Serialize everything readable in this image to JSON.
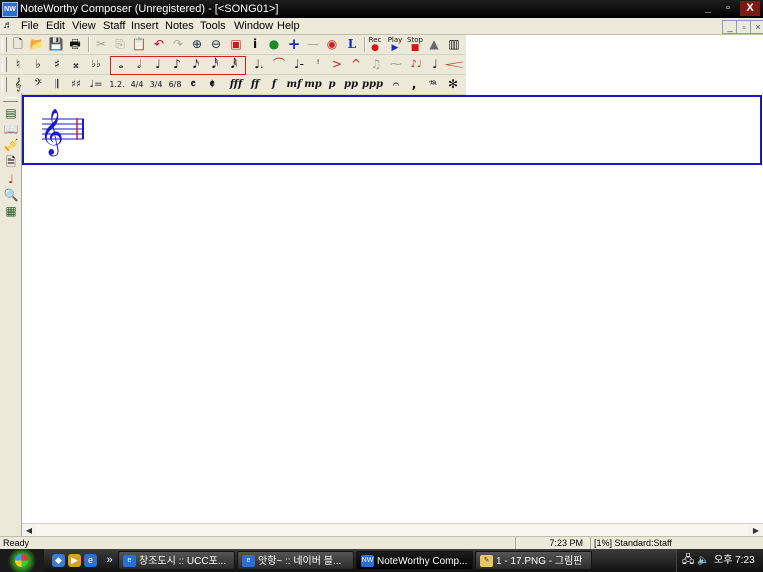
{
  "window": {
    "title": "NoteWorthy Composer (Unregistered) - [<SONG01>]",
    "app_icon_text": "NW",
    "minimize_glyph": "_",
    "restore_glyph": "▫",
    "close_glyph": "X",
    "mdi_minimize_glyph": "_",
    "mdi_restore_glyph": "▫",
    "mdi_close_glyph": "×"
  },
  "menubar": {
    "doc_icon_glyph": "♬",
    "items": [
      "File",
      "Edit",
      "View",
      "Staff",
      "Insert",
      "Notes",
      "Tools",
      "Window",
      "Help"
    ]
  },
  "toolbar_standard": {
    "buttons": [
      {
        "icon": "new-document-icon",
        "glyph": "🗋"
      },
      {
        "icon": "open-folder-icon",
        "glyph": "📂"
      },
      {
        "icon": "save-icon",
        "glyph": "💾"
      },
      {
        "icon": "print-icon",
        "glyph": "🖶"
      },
      {
        "icon": "cut-icon",
        "glyph": "✂"
      },
      {
        "icon": "copy-icon",
        "glyph": "⎘"
      },
      {
        "icon": "paste-icon",
        "glyph": "📋"
      },
      {
        "icon": "undo-icon",
        "glyph": "↶"
      },
      {
        "icon": "redo-icon",
        "glyph": "↷"
      },
      {
        "icon": "zoom-in-icon",
        "glyph": "⊕"
      },
      {
        "icon": "zoom-out-icon",
        "glyph": "⊖"
      },
      {
        "icon": "staff-properties-icon",
        "glyph": "▣"
      },
      {
        "icon": "info-icon",
        "glyph": "i"
      },
      {
        "icon": "globe-icon",
        "glyph": "●"
      },
      {
        "icon": "add-staff-icon",
        "glyph": "+"
      },
      {
        "icon": "delete-staff-icon",
        "glyph": "—"
      },
      {
        "icon": "mute-icon",
        "glyph": "◉"
      },
      {
        "icon": "lyrics-icon",
        "glyph": "L"
      }
    ],
    "rec_label": "Rec",
    "play_label": "Play",
    "stop_label": "Stop",
    "extra_icons": [
      {
        "icon": "metronome-icon",
        "glyph": "▲"
      },
      {
        "icon": "keyboard-icon",
        "glyph": "▥"
      }
    ]
  },
  "toolbar_notes": {
    "accidentals": [
      {
        "icon": "natural-icon",
        "glyph": "♮"
      },
      {
        "icon": "flat-icon",
        "glyph": "♭"
      },
      {
        "icon": "sharp-icon",
        "glyph": "♯"
      },
      {
        "icon": "double-sharp-icon",
        "glyph": "𝄪"
      },
      {
        "icon": "double-flat-icon",
        "glyph": "♭♭"
      }
    ],
    "durations": [
      {
        "icon": "whole-note-icon",
        "glyph": "𝅝"
      },
      {
        "icon": "half-note-icon",
        "glyph": "𝅗𝅥"
      },
      {
        "icon": "quarter-note-icon",
        "glyph": "♩"
      },
      {
        "icon": "eighth-note-icon",
        "glyph": "♪"
      },
      {
        "icon": "sixteenth-note-icon",
        "glyph": "𝅘𝅥𝅯"
      },
      {
        "icon": "thirty-second-note-icon",
        "glyph": "𝅘𝅥𝅰"
      },
      {
        "icon": "sixty-fourth-note-icon",
        "glyph": "𝅘𝅥𝅱"
      }
    ],
    "modifiers": [
      {
        "icon": "dotted-note-icon",
        "glyph": "♩."
      },
      {
        "icon": "tie-icon",
        "glyph": "⌒"
      },
      {
        "icon": "tenuto-icon",
        "glyph": "♩-"
      },
      {
        "icon": "staccato-icon",
        "glyph": "ꜝ"
      },
      {
        "icon": "accent-icon",
        "glyph": ">"
      },
      {
        "icon": "marcato-icon",
        "glyph": "^"
      },
      {
        "icon": "grace-icon",
        "glyph": "♫"
      },
      {
        "icon": "slur-icon",
        "glyph": "⁓"
      },
      {
        "icon": "triplet-icon",
        "glyph": "♪♩"
      },
      {
        "icon": "beam-icon",
        "glyph": "♩"
      },
      {
        "icon": "crescendo-icon",
        "glyph": "𝆒"
      }
    ]
  },
  "toolbar_symbols": {
    "items": [
      {
        "icon": "treble-clef-icon",
        "glyph": "𝄞"
      },
      {
        "icon": "bass-clef-icon",
        "glyph": "𝄢"
      },
      {
        "icon": "barline-icon",
        "glyph": "𝄂"
      },
      {
        "icon": "key-signature-icon",
        "glyph": "♯♯"
      },
      {
        "icon": "tempo-icon",
        "glyph": "♩="
      },
      {
        "icon": "ending-icon",
        "glyph": "1.2."
      },
      {
        "icon": "time-4-4-icon",
        "glyph": "4/4"
      },
      {
        "icon": "time-3-4-icon",
        "glyph": "3/4"
      },
      {
        "icon": "time-6-8-icon",
        "glyph": "6/8"
      },
      {
        "icon": "common-time-icon",
        "glyph": "𝄴"
      },
      {
        "icon": "cut-time-icon",
        "glyph": "𝄵"
      }
    ],
    "dynamics": [
      "fff",
      "ff",
      "f",
      "mf",
      "mp",
      "p",
      "pp",
      "ppp"
    ],
    "extras": [
      {
        "icon": "fermata-icon",
        "glyph": "𝄐"
      },
      {
        "icon": "breath-mark-icon",
        "glyph": ","
      },
      {
        "icon": "pedal-icon",
        "glyph": "𝆮"
      },
      {
        "icon": "pedal-release-icon",
        "glyph": "✻"
      }
    ]
  },
  "left_tools": [
    {
      "icon": "staff-manager-icon",
      "glyph": "▤"
    },
    {
      "icon": "book-icon",
      "glyph": "📖"
    },
    {
      "icon": "instrument-icon",
      "glyph": "🎺"
    },
    {
      "icon": "print-preview-icon",
      "glyph": "🗎"
    },
    {
      "icon": "note-color-icon",
      "glyph": "♩"
    },
    {
      "icon": "find-icon",
      "glyph": "🔍"
    },
    {
      "icon": "tile-view-icon",
      "glyph": "▦"
    }
  ],
  "statusbar": {
    "ready": "Ready",
    "time": "7:23 PM",
    "staff_info": "[1%] Standard:Staff"
  },
  "taskbar": {
    "overflow": "»",
    "tasks": [
      {
        "label": "창조도시 :: UCC포...",
        "icon": "browser-icon"
      },
      {
        "label": "앗항~ :: 네이버 블...",
        "icon": "browser-icon"
      },
      {
        "label": "NoteWorthy Comp...",
        "icon": "noteworthy-icon"
      },
      {
        "label": "1 - 17.PNG - 그림판",
        "icon": "paint-icon"
      }
    ],
    "clock": "오후 7:23"
  },
  "colors": {
    "staff_border": "#1818c8",
    "staff_ink": "#1a1ad0",
    "cursor_red": "#cc2222"
  }
}
